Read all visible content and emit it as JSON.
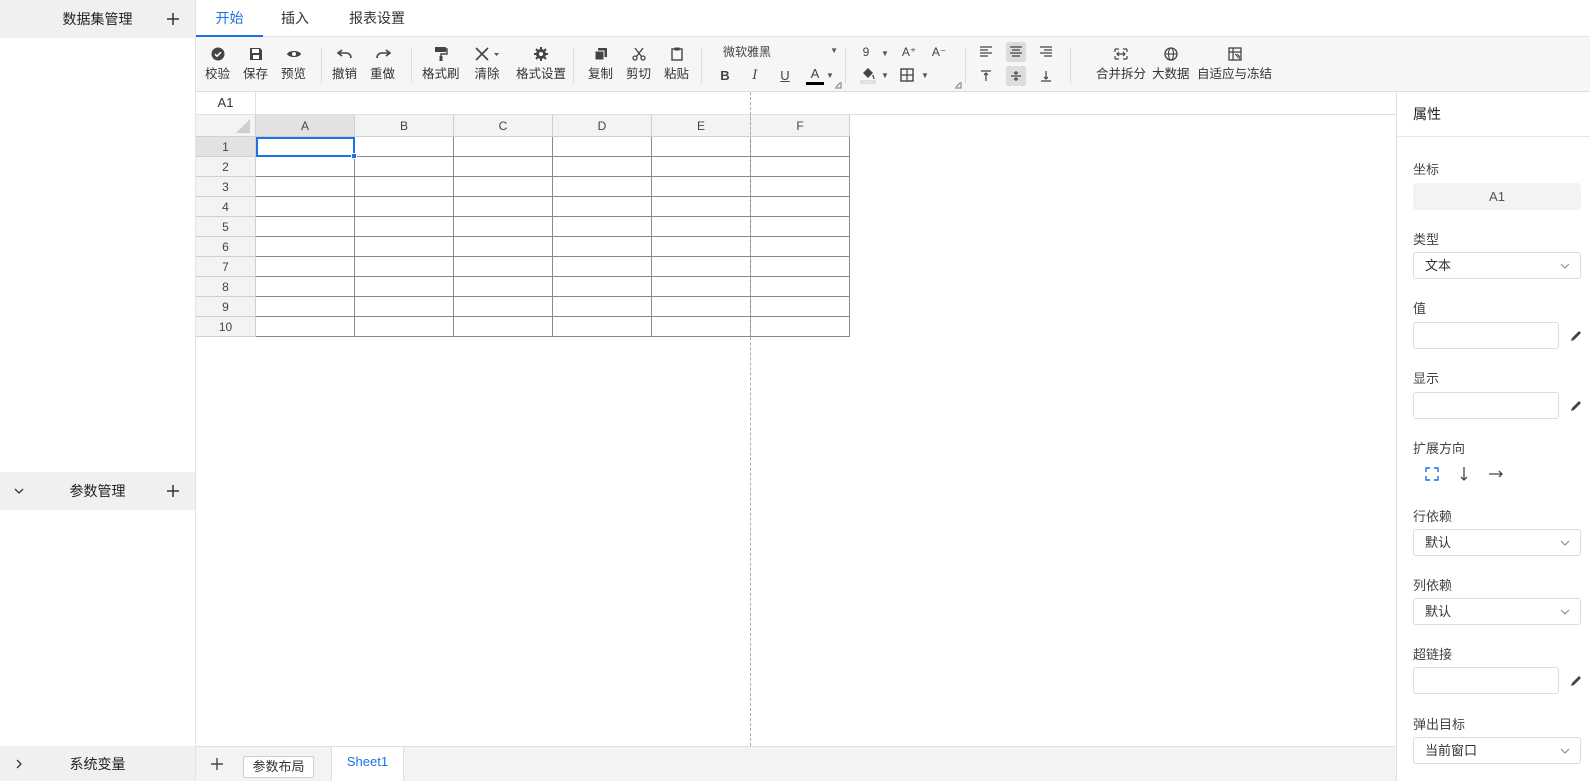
{
  "sidebar": {
    "sections": [
      {
        "label": "数据集管理",
        "chevron": "",
        "action": "+"
      },
      {
        "label": "参数管理",
        "chevron": "chevron-down",
        "action": "+"
      },
      {
        "label": "系统变量",
        "chevron": "chevron-right",
        "action": ""
      }
    ]
  },
  "tabs": [
    {
      "label": "开始",
      "active": true
    },
    {
      "label": "插入",
      "active": false
    },
    {
      "label": "报表设置",
      "active": false
    }
  ],
  "toolbar": {
    "check": "校验",
    "save": "保存",
    "preview": "预览",
    "undo": "撤销",
    "redo": "重做",
    "format_painter": "格式刷",
    "clear": "清除",
    "format_settings": "格式设置",
    "copy": "复制",
    "cut": "剪切",
    "paste": "粘贴",
    "font_family": "微软雅黑",
    "font_size": "9",
    "bold": "B",
    "italic": "I",
    "underline": "U",
    "font_color": "A",
    "grow_font": "A⁺",
    "shrink_font": "A⁻",
    "merge_split": "合并拆分",
    "big_data": "大数据",
    "auto_fit_freeze": "自适应与冻结"
  },
  "formula_bar": {
    "cell_ref": "A1"
  },
  "grid": {
    "columns": [
      "A",
      "B",
      "C",
      "D",
      "E",
      "F"
    ],
    "rows": [
      "1",
      "2",
      "3",
      "4",
      "5",
      "6",
      "7",
      "8",
      "9",
      "10"
    ],
    "selected_cell": "A1"
  },
  "sheetbar": {
    "add": "+",
    "param_layout": "参数布局",
    "sheet_name": "Sheet1"
  },
  "panel": {
    "title": "属性",
    "coordinate_label": "坐标",
    "coordinate_value": "A1",
    "type_label": "类型",
    "type_value": "文本",
    "value_label": "值",
    "value_value": "",
    "display_label": "显示",
    "display_value": "",
    "expand_label": "扩展方向",
    "row_dep_label": "行依赖",
    "row_dep_value": "默认",
    "col_dep_label": "列依赖",
    "col_dep_value": "默认",
    "hyperlink_label": "超链接",
    "hyperlink_value": "",
    "popup_target_label": "弹出目标",
    "popup_target_value": "当前窗口"
  },
  "colors": {
    "accent": "#1a73e8"
  }
}
